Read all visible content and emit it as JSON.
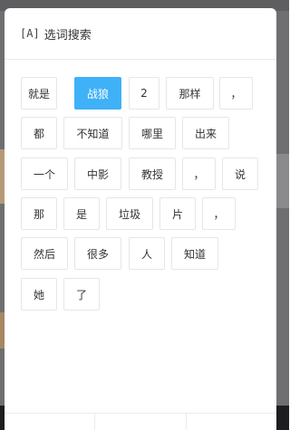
{
  "dialog": {
    "title_icon": "[A]",
    "title": "选词搜索"
  },
  "words": [
    {
      "text": "就是",
      "selected": false
    },
    {
      "text": "战狼",
      "selected": true
    },
    {
      "text": "2",
      "selected": false
    },
    {
      "text": "那样",
      "selected": false
    },
    {
      "text": "，",
      "selected": false
    },
    {
      "text": "都",
      "selected": false
    },
    {
      "text": "不知道",
      "selected": false
    },
    {
      "text": "哪里",
      "selected": false
    },
    {
      "text": "出来",
      "selected": false
    },
    {
      "text": "一个",
      "selected": false
    },
    {
      "text": "中影",
      "selected": false
    },
    {
      "text": "教授",
      "selected": false
    },
    {
      "text": "，",
      "selected": false
    },
    {
      "text": "说",
      "selected": false
    },
    {
      "text": "那",
      "selected": false
    },
    {
      "text": "是",
      "selected": false
    },
    {
      "text": "垃圾",
      "selected": false
    },
    {
      "text": "片",
      "selected": false
    },
    {
      "text": "，",
      "selected": false
    },
    {
      "text": "然后",
      "selected": false
    },
    {
      "text": "很多",
      "selected": false
    },
    {
      "text": "人",
      "selected": false
    },
    {
      "text": "知道",
      "selected": false
    },
    {
      "text": "她",
      "selected": false
    },
    {
      "text": "了",
      "selected": false
    }
  ],
  "footer": {
    "buttons": [
      "",
      "",
      ""
    ]
  }
}
